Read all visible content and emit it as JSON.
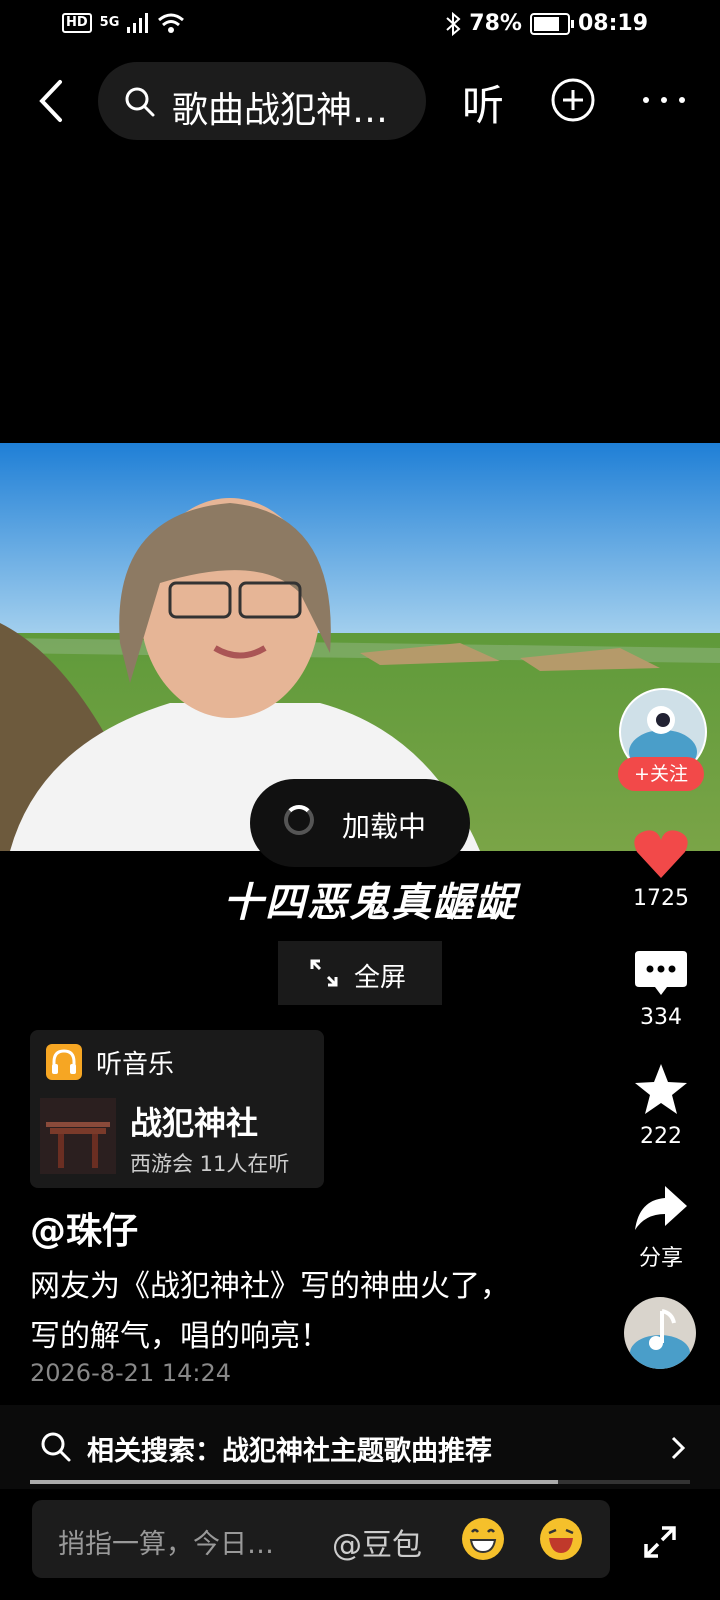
{
  "status_bar": {
    "network_hd": "HD",
    "network_5g": "5G",
    "battery": "78%",
    "battery_level": 0.78,
    "time": "08:19"
  },
  "header": {
    "search_text": "歌曲战犯神…",
    "listen_label": "听"
  },
  "video": {
    "loading_text": "加载中",
    "subtitle": "十四恶鬼真龌龊",
    "fullscreen_label": "全屏"
  },
  "sidebar": {
    "follow_label": "+关注",
    "likes": "1725",
    "comments": "334",
    "favorites": "222",
    "share_label": "分享"
  },
  "music": {
    "header_label": "听音乐",
    "title": "战犯神社",
    "subtitle": "西游会 11人在听"
  },
  "post": {
    "author": "@珠仔",
    "description": "网友为《战犯神社》写的神曲火了，写的解气，唱的响亮！",
    "date": "2026-8-21 14:24"
  },
  "related_search": {
    "label": "相关搜索：战犯神社主题歌曲推荐"
  },
  "playback": {
    "progress": 0.8
  },
  "comment_input": {
    "placeholder": "捎指一算，今日…",
    "mention": "@豆包"
  },
  "colors": {
    "like": "#f24949",
    "follow": "#f24949",
    "music_icon": "#f6a623"
  }
}
